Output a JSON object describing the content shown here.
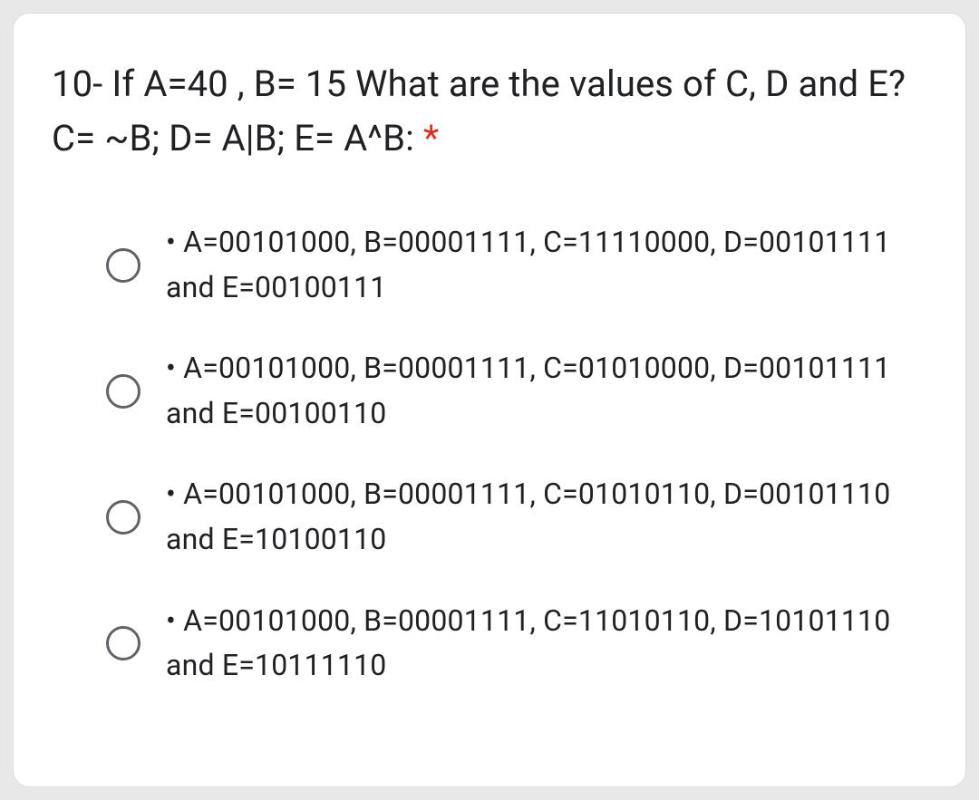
{
  "question": {
    "text": "10- If A=40 , B= 15 What are the values of C, D and E? C= ~B; D= A|B; E= A^B:",
    "required_marker": "*"
  },
  "options": [
    {
      "text": "• A=00101000, B=00001111, C=11110000, D=00101111 and E=00100111"
    },
    {
      "text": "• A=00101000, B=00001111, C=01010000, D=00101111 and E=00100110"
    },
    {
      "text": "• A=00101000, B=00001111, C=01010110, D=00101110 and E=10100110"
    },
    {
      "text": "• A=00101000, B=00001111, C=11010110, D=10101110 and E=10111110"
    }
  ]
}
